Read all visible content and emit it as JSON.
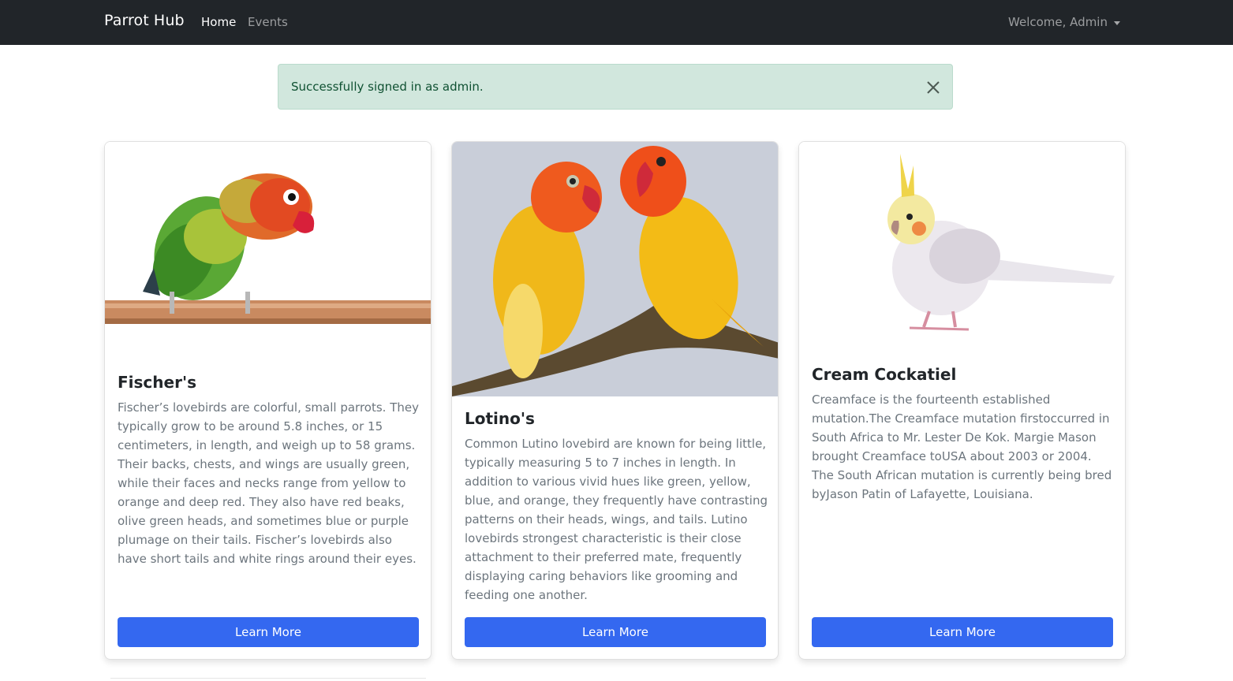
{
  "navbar": {
    "brand": "Parrot Hub",
    "links": [
      {
        "label": "Home"
      },
      {
        "label": "Events"
      }
    ],
    "user_menu": "Welcome, Admin"
  },
  "alert": {
    "message": "Successfully signed in as admin."
  },
  "cards": [
    {
      "title": "Fischer's",
      "description": "Fischer’s lovebirds are colorful, small parrots. They typically grow to be around 5.8 inches, or 15 centimeters, in length, and weigh up to 58 grams. Their backs, chests, and wings are usually green, while their faces and necks range from yellow to orange and deep red. They also have red beaks, olive green heads, and sometimes blue or purple plumage on their tails. Fischer’s lovebirds also have short tails and white rings around their eyes.",
      "button": "Learn More"
    },
    {
      "title": "Lotino's",
      "description": "Common Lutino lovebird are known for being little, typically measuring 5 to 7 inches in length. In addition to various vivid hues like green, yellow, blue, and orange, they frequently have contrasting patterns on their heads, wings, and tails. Lutino lovebirds strongest characteristic is their close attachment to their preferred mate, frequently displaying caring behaviors like grooming and feeding one another.",
      "button": "Learn More"
    },
    {
      "title": "Cream Cockatiel",
      "description": "Creamface is the fourteenth established mutation.The Creamface mutation firstoccurred in South Africa to Mr. Lester De Kok. Margie Mason brought Creamface toUSA about 2003 or 2004. The South African mutation is currently being bred byJason Patin of Lafayette, Louisiana.",
      "button": "Learn More"
    }
  ],
  "colors": {
    "navbar_bg": "#212529",
    "alert_bg": "#d1e7dd",
    "alert_text": "#0f5132",
    "button_bg": "#3468f0"
  }
}
